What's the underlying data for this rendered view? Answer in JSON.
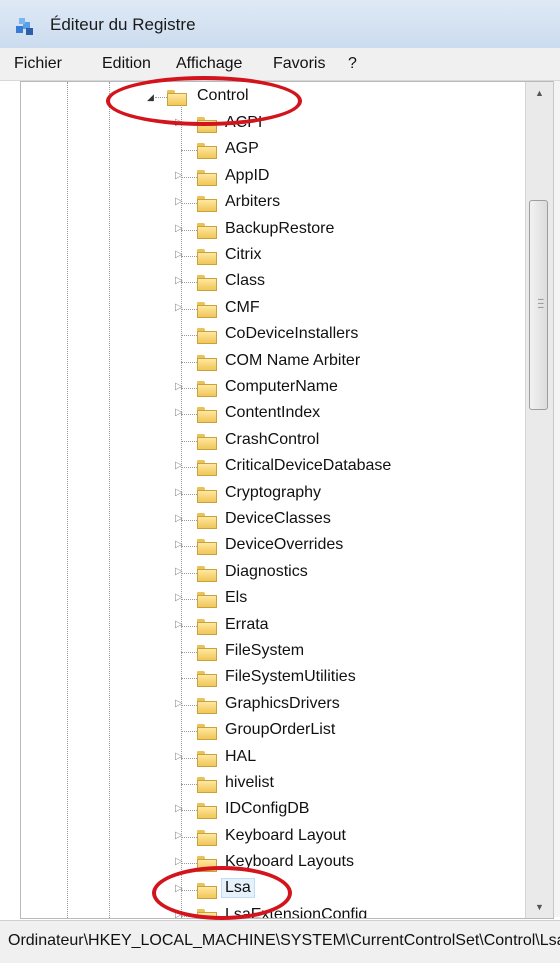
{
  "window": {
    "title": "Éditeur du Registre",
    "app_icon": "regedit-icon"
  },
  "menu": [
    "Fichier",
    "Edition",
    "Affichage",
    "Favoris",
    "?"
  ],
  "tree": {
    "root": {
      "label": "Control",
      "expanded": true
    },
    "children": [
      {
        "label": "ACPI",
        "expandable": true
      },
      {
        "label": "AGP",
        "expandable": false
      },
      {
        "label": "AppID",
        "expandable": true
      },
      {
        "label": "Arbiters",
        "expandable": true
      },
      {
        "label": "BackupRestore",
        "expandable": true
      },
      {
        "label": "Citrix",
        "expandable": true
      },
      {
        "label": "Class",
        "expandable": true
      },
      {
        "label": "CMF",
        "expandable": true
      },
      {
        "label": "CoDeviceInstallers",
        "expandable": false
      },
      {
        "label": "COM Name Arbiter",
        "expandable": false
      },
      {
        "label": "ComputerName",
        "expandable": true
      },
      {
        "label": "ContentIndex",
        "expandable": true
      },
      {
        "label": "CrashControl",
        "expandable": false
      },
      {
        "label": "CriticalDeviceDatabase",
        "expandable": true
      },
      {
        "label": "Cryptography",
        "expandable": true
      },
      {
        "label": "DeviceClasses",
        "expandable": true
      },
      {
        "label": "DeviceOverrides",
        "expandable": true
      },
      {
        "label": "Diagnostics",
        "expandable": true
      },
      {
        "label": "Els",
        "expandable": true
      },
      {
        "label": "Errata",
        "expandable": true
      },
      {
        "label": "FileSystem",
        "expandable": false
      },
      {
        "label": "FileSystemUtilities",
        "expandable": false
      },
      {
        "label": "GraphicsDrivers",
        "expandable": true
      },
      {
        "label": "GroupOrderList",
        "expandable": false
      },
      {
        "label": "HAL",
        "expandable": true
      },
      {
        "label": "hivelist",
        "expandable": false
      },
      {
        "label": "IDConfigDB",
        "expandable": true
      },
      {
        "label": "Keyboard Layout",
        "expandable": true
      },
      {
        "label": "Keyboard Layouts",
        "expandable": true
      },
      {
        "label": "Lsa",
        "expandable": true,
        "selected": true
      },
      {
        "label": "LsaExtensionConfig",
        "expandable": true
      }
    ]
  },
  "statusbar": {
    "path": "Ordinateur\\HKEY_LOCAL_MACHINE\\SYSTEM\\CurrentControlSet\\Control\\Lsa"
  },
  "colors": {
    "annotation": "#d3141c",
    "selection": "#e5f1fb"
  }
}
